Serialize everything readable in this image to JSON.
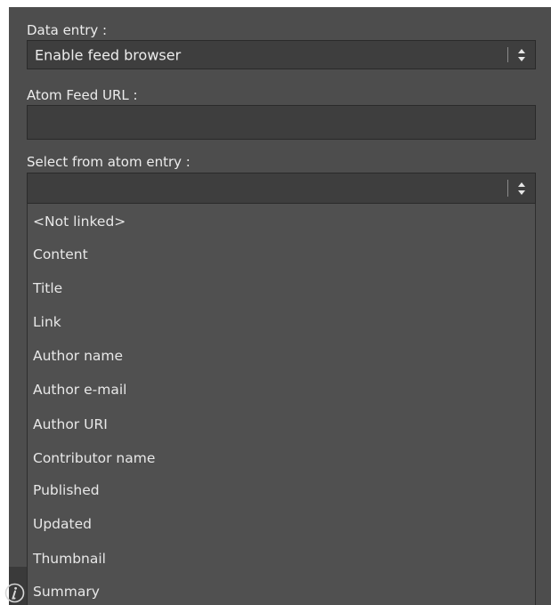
{
  "data_entry": {
    "label": "Data entry :",
    "selected": "Enable feed browser",
    "icon": "up-down-arrows-icon"
  },
  "atom_feed_url": {
    "label": "Atom Feed URL :",
    "value": ""
  },
  "atom_entry": {
    "label": "Select from atom entry :",
    "selected": "",
    "icon": "up-down-arrows-icon",
    "options": [
      "<Not linked>",
      "Content",
      "Title",
      "Link",
      "Author name",
      "Author e-mail",
      "Author URI",
      "Contributor name",
      "Published",
      "Updated",
      "Thumbnail",
      "Summary"
    ]
  },
  "footer": {
    "icon": "info-icon"
  },
  "colors": {
    "panel": "#4d4d4d",
    "field": "#3e3e3e",
    "dropdown": "#505050",
    "text": "#e6e6e6"
  }
}
